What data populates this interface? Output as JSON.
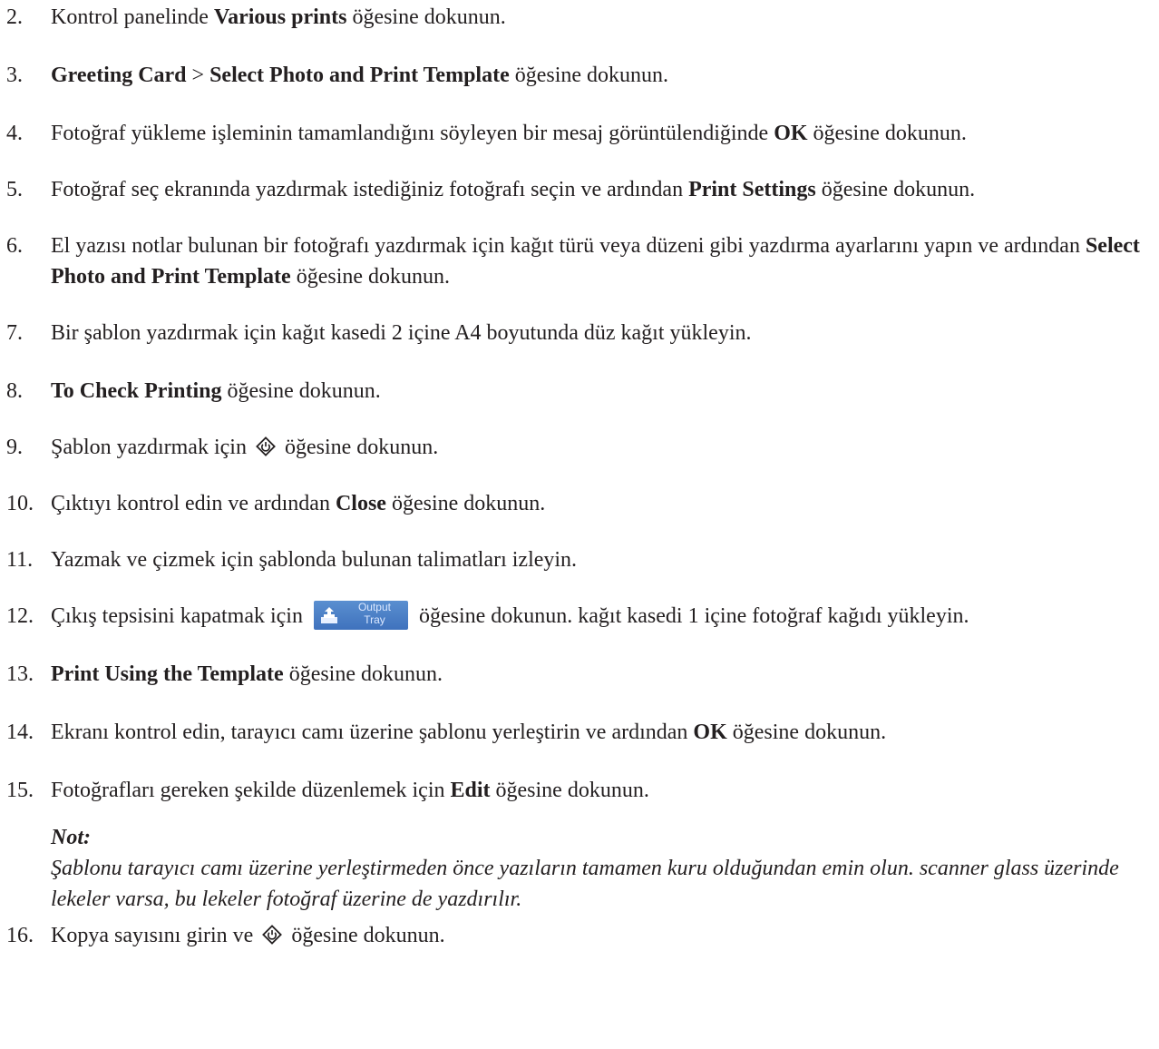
{
  "steps": [
    {
      "num": "2.",
      "parts": [
        {
          "t": "Kontrol panelinde "
        },
        {
          "b": "Various prints"
        },
        {
          "t": " öğesine dokunun."
        }
      ]
    },
    {
      "num": "3.",
      "parts": [
        {
          "b": "Greeting Card"
        },
        {
          "t": " > "
        },
        {
          "b": "Select Photo and Print Template"
        },
        {
          "t": " öğesine dokunun."
        }
      ]
    },
    {
      "num": "4.",
      "parts": [
        {
          "t": "Fotoğraf yükleme işleminin tamamlandığını söyleyen bir mesaj görüntülendiğinde "
        },
        {
          "b": "OK"
        },
        {
          "t": " öğesine dokunun."
        }
      ]
    },
    {
      "num": "5.",
      "parts": [
        {
          "t": "Fotoğraf seç ekranında yazdırmak istediğiniz fotoğrafı seçin ve ardından "
        },
        {
          "b": "Print Settings"
        },
        {
          "t": " öğesine dokunun."
        }
      ]
    },
    {
      "num": "6.",
      "parts": [
        {
          "t": "El yazısı notlar bulunan bir fotoğrafı yazdırmak için kağıt türü veya düzeni gibi yazdırma ayarlarını yapın ve ardından "
        },
        {
          "b": "Select Photo and Print Template"
        },
        {
          "t": " öğesine dokunun."
        }
      ]
    },
    {
      "num": "7.",
      "parts": [
        {
          "t": "Bir şablon yazdırmak için kağıt kasedi 2 içine A4 boyutunda düz kağıt yükleyin."
        }
      ]
    },
    {
      "num": "8.",
      "parts": [
        {
          "b": "To Check Printing"
        },
        {
          "t": " öğesine dokunun."
        }
      ]
    },
    {
      "num": "9.",
      "parts": [
        {
          "t": "Şablon yazdırmak için "
        },
        {
          "icon": "start-icon"
        },
        {
          "t": " öğesine dokunun."
        }
      ]
    },
    {
      "num": "10.",
      "parts": [
        {
          "t": "Çıktıyı kontrol edin ve ardından "
        },
        {
          "b": "Close"
        },
        {
          "t": " öğesine dokunun."
        }
      ]
    },
    {
      "num": "11.",
      "parts": [
        {
          "t": "Yazmak ve çizmek için şablonda bulunan talimatları izleyin."
        }
      ]
    },
    {
      "num": "12.",
      "parts": [
        {
          "t": "Çıkış tepsisini kapatmak için "
        },
        {
          "icon": "output-tray-icon"
        },
        {
          "t": " öğesine dokunun. kağıt kasedi 1 içine fotoğraf kağıdı yükleyin."
        }
      ]
    },
    {
      "num": "13.",
      "parts": [
        {
          "b": "Print Using the Template"
        },
        {
          "t": " öğesine dokunun."
        }
      ]
    },
    {
      "num": "14.",
      "parts": [
        {
          "t": "Ekranı kontrol edin, tarayıcı camı üzerine şablonu yerleştirin ve ardından "
        },
        {
          "b": "OK"
        },
        {
          "t": " öğesine dokunun."
        }
      ]
    },
    {
      "num": "15.",
      "parts": [
        {
          "t": "Fotoğrafları gereken şekilde düzenlemek için "
        },
        {
          "b": "Edit"
        },
        {
          "t": " öğesine dokunun."
        }
      ]
    },
    {
      "num": "16.",
      "parts": [
        {
          "t": "Kopya sayısını girin ve "
        },
        {
          "icon": "start-icon"
        },
        {
          "t": " öğesine dokunun."
        }
      ]
    }
  ],
  "note": {
    "label": "Not:",
    "text": "Şablonu tarayıcı camı üzerine yerleştirmeden önce yazıların tamamen kuru olduğundan emin olun. scanner glass üzerinde lekeler varsa, bu lekeler fotoğraf üzerine de yazdırılır."
  },
  "output_tray_button": {
    "label_line1": "Output",
    "label_line2": "Tray",
    "color": "#4a7fc6"
  },
  "colors": {
    "text": "#231f20"
  }
}
